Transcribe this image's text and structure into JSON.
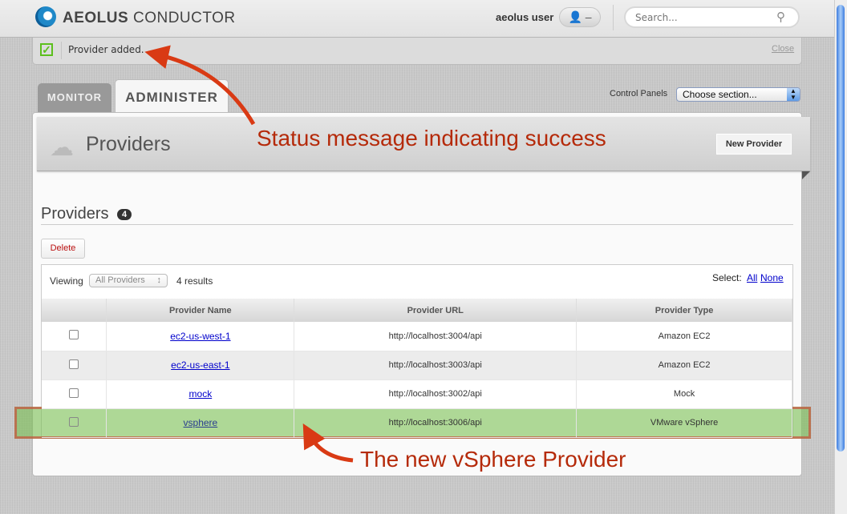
{
  "header": {
    "brand_bold": "AEOLUS",
    "brand_rest": "CONDUCTOR",
    "user": "aeolus user",
    "search_placeholder": "Search..."
  },
  "notice": {
    "message": "Provider added.",
    "close": "Close"
  },
  "tabs": [
    {
      "label": "MONITOR"
    },
    {
      "label": "ADMINISTER"
    }
  ],
  "control_panels": {
    "label": "Control Panels",
    "value": "Choose section..."
  },
  "page": {
    "title": "Providers",
    "new_button": "New Provider",
    "section_title": "Providers",
    "count": "4",
    "delete": "Delete"
  },
  "table": {
    "viewing_label": "Viewing",
    "filter": "All Providers",
    "results": "4 results",
    "select_label": "Select:",
    "select_all": "All",
    "select_none": "None",
    "columns": [
      "",
      "Provider Name",
      "Provider URL",
      "Provider Type"
    ],
    "rows": [
      {
        "name": "ec2-us-west-1",
        "url": "http://localhost:3004/api",
        "type": "Amazon EC2"
      },
      {
        "name": "ec2-us-east-1",
        "url": "http://localhost:3003/api",
        "type": "Amazon EC2"
      },
      {
        "name": "mock",
        "url": "http://localhost:3002/api",
        "type": "Mock"
      },
      {
        "name": "vsphere",
        "url": "http://localhost:3006/api",
        "type": "VMware vSphere"
      }
    ]
  },
  "annotations": {
    "status": "Status message indicating success",
    "new_provider": "The new vSphere Provider",
    "color": "#b52a0a"
  }
}
